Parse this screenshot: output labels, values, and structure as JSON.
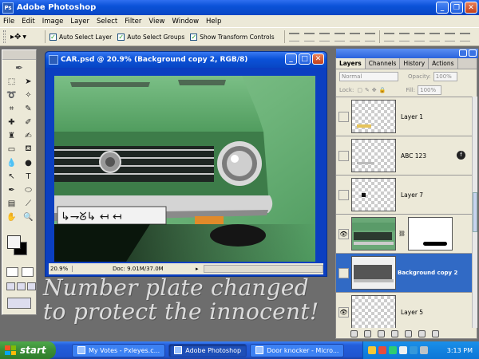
{
  "app": {
    "title": "Adobe Photoshop"
  },
  "menu": [
    "File",
    "Edit",
    "Image",
    "Layer",
    "Select",
    "Filter",
    "View",
    "Window",
    "Help"
  ],
  "options": {
    "auto_select_layer": "Auto Select Layer",
    "auto_select_groups": "Auto Select Groups",
    "show_transform_controls": "Show Transform Controls"
  },
  "document": {
    "title": "CAR.psd @ 20.9% (Background copy 2, RGB/8)",
    "zoom": "20.9%",
    "doc_info": "Doc: 9.01M/37.0M"
  },
  "layers_panel": {
    "tabs": [
      "Layers",
      "Channels",
      "History",
      "Actions"
    ],
    "blend_mode": "Normal",
    "opacity_label": "Opacity:",
    "opacity_value": "100%",
    "lock_label": "Lock:",
    "fill_label": "Fill:",
    "fill_value": "100%",
    "layers": [
      {
        "name": "Layer 1",
        "visible": false,
        "selected": false
      },
      {
        "name": "ABC   123",
        "visible": false,
        "selected": false
      },
      {
        "name": "Layer 7",
        "visible": false,
        "selected": false
      },
      {
        "name": "",
        "visible": true,
        "selected": false
      },
      {
        "name": "Background copy 2",
        "visible": false,
        "selected": true
      },
      {
        "name": "Layer 5",
        "visible": true,
        "selected": false
      }
    ]
  },
  "caption": {
    "line1": "Number plate changed",
    "line2": "to protect the innocent!"
  },
  "taskbar": {
    "start": "start",
    "tasks": [
      "My Votes - Pxleyes.c...",
      "Adobe Photoshop",
      "Door knocker - Micro..."
    ],
    "clock": "3:13 PM"
  }
}
